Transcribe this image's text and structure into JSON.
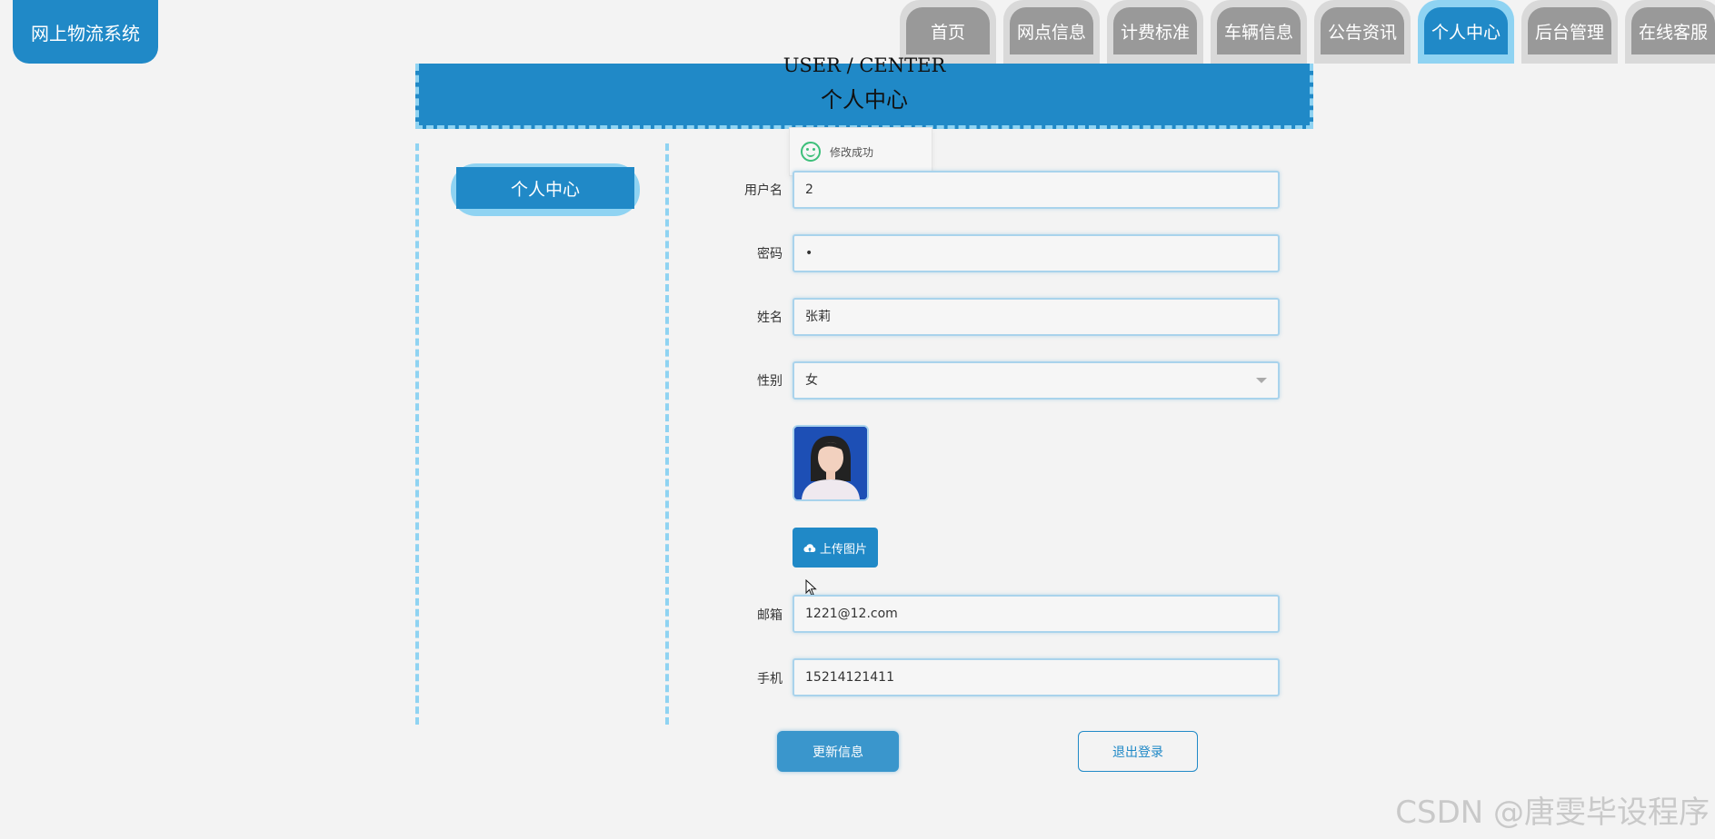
{
  "app": {
    "title": "网上物流系统"
  },
  "nav": {
    "items": [
      {
        "label": "首页"
      },
      {
        "label": "网点信息"
      },
      {
        "label": "计费标准"
      },
      {
        "label": "车辆信息"
      },
      {
        "label": "公告资讯"
      },
      {
        "label": "个人中心",
        "active": true
      },
      {
        "label": "后台管理"
      },
      {
        "label": "在线客服"
      }
    ]
  },
  "banner": {
    "en_title": "USER / CENTER",
    "cn_title": "个人中心"
  },
  "sidebar": {
    "button_label": "个人中心"
  },
  "toast": {
    "message": "修改成功",
    "icon": "smile-icon"
  },
  "form": {
    "username": {
      "label": "用户名",
      "value": "2"
    },
    "password": {
      "label": "密码",
      "value": "•"
    },
    "name": {
      "label": "姓名",
      "value": "张莉"
    },
    "gender": {
      "label": "性别",
      "value": "女"
    },
    "avatar": {
      "icon": "avatar-photo"
    },
    "upload_label": "上传图片",
    "email": {
      "label": "邮箱",
      "value": "1221@12.com"
    },
    "phone": {
      "label": "手机",
      "value": "15214121411"
    }
  },
  "actions": {
    "update_label": "更新信息",
    "logout_label": "退出登录"
  },
  "watermark": "CSDN @唐雯毕设程序",
  "colors": {
    "primary": "#2089c7",
    "accent": "#8fd3f2",
    "inactive_tab": "#999999"
  }
}
